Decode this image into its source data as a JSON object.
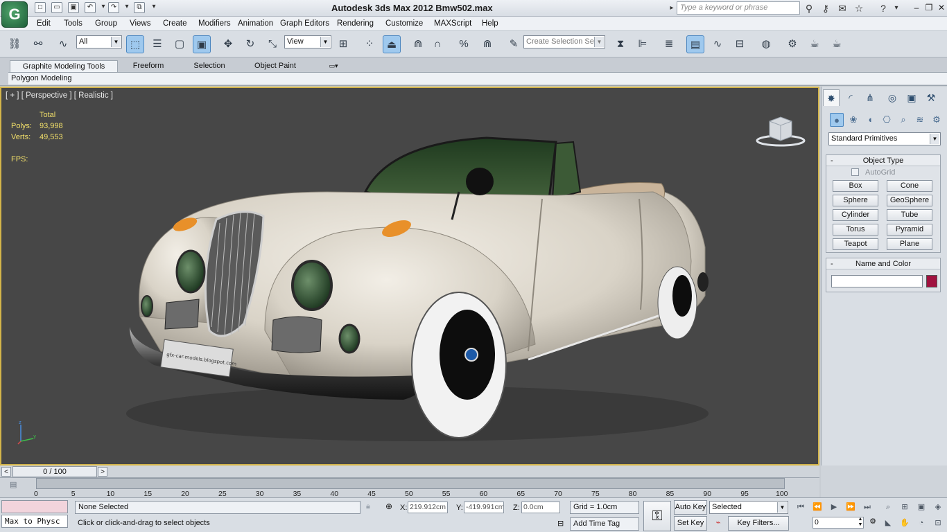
{
  "window": {
    "app_logo_letter": "G",
    "title": "Autodesk 3ds Max  2012      Bmw502.max",
    "search_placeholder": "Type a keyword or phrase"
  },
  "menu": [
    "Edit",
    "Tools",
    "Group",
    "Views",
    "Create",
    "Modifiers",
    "Animation",
    "Graph Editors",
    "Rendering",
    "Customize",
    "MAXScript",
    "Help"
  ],
  "toolbar": {
    "selection_filter": "All",
    "reference_coord": "View",
    "named_selection": "Create Selection Set"
  },
  "ribbon": {
    "tabs": [
      "Graphite Modeling Tools",
      "Freeform",
      "Selection",
      "Object Paint"
    ],
    "panel_label": "Polygon Modeling"
  },
  "viewport": {
    "label": "[ + ] [ Perspective ] [ Realistic ]",
    "stats_header": "Total",
    "polys_label": "Polys:",
    "polys_value": "93,998",
    "verts_label": "Verts:",
    "verts_value": "49,553",
    "fps_label": "FPS:",
    "plate_text": "gfx-car-models.blogspot.com",
    "colors": {
      "background": "#474747",
      "border": "#d4b54a",
      "stats": "#f3e06a"
    }
  },
  "command_panel": {
    "primitive_type": "Standard Primitives",
    "object_type_title": "Object Type",
    "autogrid_label": "AutoGrid",
    "buttons": [
      "Box",
      "Cone",
      "Sphere",
      "GeoSphere",
      "Cylinder",
      "Tube",
      "Torus",
      "Pyramid",
      "Teapot",
      "Plane"
    ],
    "name_color_title": "Name and Color",
    "object_color": "#a0123f"
  },
  "timeline": {
    "frame_label": "0 / 100",
    "ticks": [
      "0",
      "5",
      "10",
      "15",
      "20",
      "25",
      "30",
      "35",
      "40",
      "45",
      "50",
      "55",
      "60",
      "65",
      "70",
      "75",
      "80",
      "85",
      "90",
      "95",
      "100"
    ]
  },
  "status": {
    "maxscript_text": "Max to Physc",
    "selection_text": "None Selected",
    "prompt_text": "Click or click-and-drag to select objects",
    "x_label": "X:",
    "x_value": "219.912cm",
    "y_label": "Y:",
    "y_value": "-419.991cm",
    "z_label": "Z:",
    "z_value": "0.0cm",
    "grid_text": "Grid = 1.0cm",
    "add_time_tag": "Add Time Tag",
    "auto_key": "Auto Key",
    "set_key": "Set Key",
    "key_mode": "Selected",
    "key_filters": "Key Filters...",
    "frame_value": "0"
  }
}
